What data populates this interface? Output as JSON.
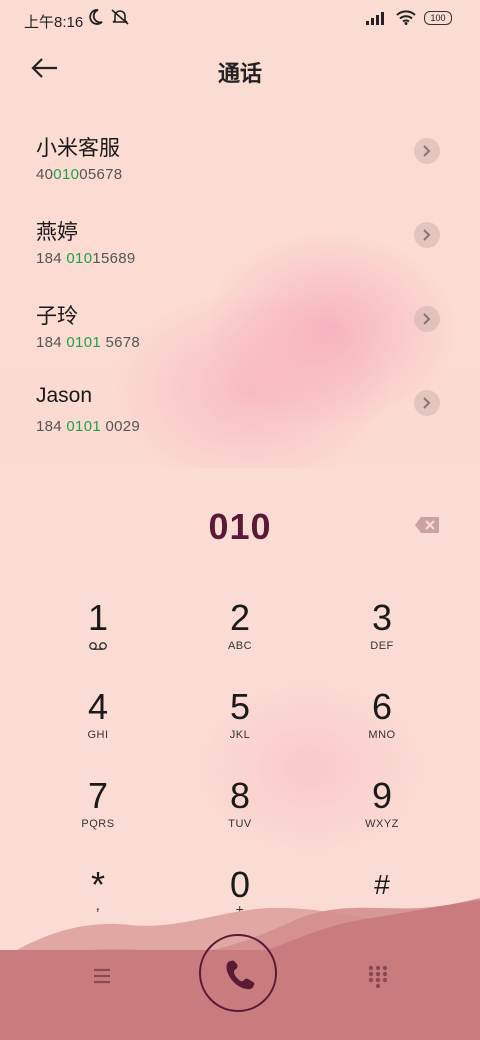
{
  "status_bar": {
    "time": "上午8:16",
    "icons_left": [
      "moon-icon",
      "bell-muted-icon"
    ],
    "icons_right": [
      "signal-icon",
      "wifi-icon",
      "battery-icon"
    ],
    "battery": "100"
  },
  "header": {
    "title": "通话",
    "back_icon": "back-arrow-icon"
  },
  "contacts": [
    {
      "name": "小米客服",
      "number_pre": "40",
      "number_hl": "010",
      "number_post": "05678"
    },
    {
      "name": "燕婷",
      "number_pre": "184 ",
      "number_hl": "010",
      "number_post": "15689"
    },
    {
      "name": "子玲",
      "number_pre": "184 ",
      "number_hl": "0101",
      "number_post": " 5678"
    },
    {
      "name": "Jason",
      "number_pre": "184 ",
      "number_hl": "0101",
      "number_post": " 0029"
    }
  ],
  "dial": {
    "entered": "010"
  },
  "keypad": [
    {
      "digit": "1",
      "letters": "",
      "icon": "voicemail-icon"
    },
    {
      "digit": "2",
      "letters": "ABC"
    },
    {
      "digit": "3",
      "letters": "DEF"
    },
    {
      "digit": "4",
      "letters": "GHI"
    },
    {
      "digit": "5",
      "letters": "JKL"
    },
    {
      "digit": "6",
      "letters": "MNO"
    },
    {
      "digit": "7",
      "letters": "PQRS"
    },
    {
      "digit": "8",
      "letters": "TUV"
    },
    {
      "digit": "9",
      "letters": "WXYZ"
    },
    {
      "digit": "*",
      "letters": ","
    },
    {
      "digit": "0",
      "letters": "+"
    },
    {
      "digit": "#",
      "letters": ""
    }
  ],
  "colors": {
    "accent": "#5a1a35",
    "highlight": "#1aa34a",
    "wave_dark": "#c97c7e",
    "wave_light": "#e1a7a2"
  }
}
